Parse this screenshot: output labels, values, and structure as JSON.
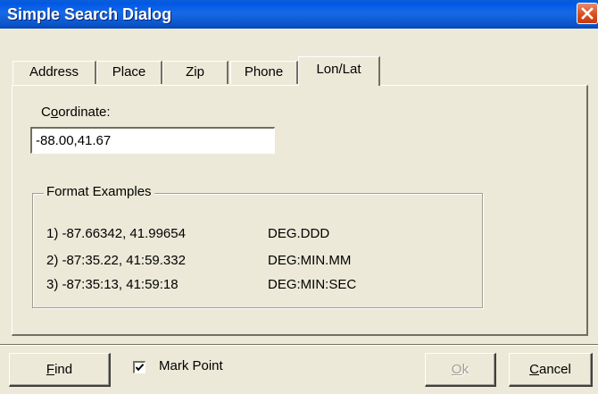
{
  "window": {
    "title": "Simple Search Dialog"
  },
  "tabs": [
    {
      "label": "Address",
      "active": false
    },
    {
      "label": "Place",
      "active": false
    },
    {
      "label": "Zip",
      "active": false
    },
    {
      "label": "Phone",
      "active": false
    },
    {
      "label": "Lon/Lat",
      "active": true
    }
  ],
  "coordinate": {
    "label_prefix": "C",
    "label_underlined": "o",
    "label_rest": "ordinate:",
    "value": "-88.00,41.67"
  },
  "format_examples": {
    "title": "Format Examples",
    "rows": [
      {
        "example": "1) -87.66342,  41.99654",
        "format": "DEG.DDD"
      },
      {
        "example": "2) -87:35.22,  41:59.332",
        "format": "DEG:MIN.MM"
      },
      {
        "example": "3) -87:35:13,  41:59:18",
        "format": "DEG:MIN:SEC"
      }
    ]
  },
  "buttons": {
    "find": {
      "mnemonic": "F",
      "rest": "ind"
    },
    "ok": {
      "mnemonic": "O",
      "rest": "k",
      "enabled": false
    },
    "cancel": {
      "mnemonic": "C",
      "rest": "ancel"
    }
  },
  "mark_point": {
    "label": "Mark Point",
    "checked": true
  },
  "colors": {
    "titlebar": "#0058e6",
    "face": "#ece9d8",
    "close": "#d8501f"
  },
  "icons": {
    "close": "close-icon",
    "check": "checkmark-icon"
  }
}
